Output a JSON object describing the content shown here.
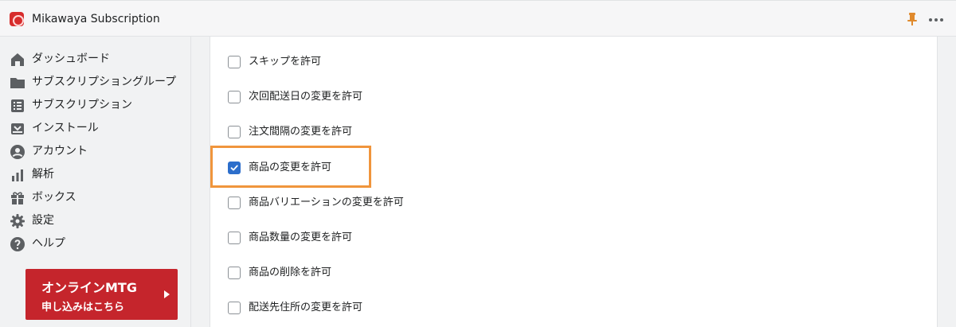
{
  "app": {
    "title": "Mikawaya Subscription"
  },
  "topbar": {
    "pin_icon": "pin-icon",
    "more_icon": "more-icon"
  },
  "sidebar": {
    "items": [
      {
        "label": "ダッシュボード",
        "icon": "home-icon"
      },
      {
        "label": "サブスクリプショングループ",
        "icon": "folder-icon"
      },
      {
        "label": "サブスクリプション",
        "icon": "list-icon"
      },
      {
        "label": "インストール",
        "icon": "inbox-icon"
      },
      {
        "label": "アカウント",
        "icon": "user-icon"
      },
      {
        "label": "解析",
        "icon": "analytics-icon"
      },
      {
        "label": "ボックス",
        "icon": "gift-icon"
      },
      {
        "label": "設定",
        "icon": "gear-icon"
      },
      {
        "label": "ヘルプ",
        "icon": "help-icon"
      }
    ]
  },
  "cta": {
    "title": "オンラインMTG",
    "subtitle": "申し込みはこちら"
  },
  "options": [
    {
      "label": "スキップを許可",
      "checked": false
    },
    {
      "label": "次回配送日の変更を許可",
      "checked": false
    },
    {
      "label": "注文間隔の変更を許可",
      "checked": false
    },
    {
      "label": "商品の変更を許可",
      "checked": true
    },
    {
      "label": "商品バリエーションの変更を許可",
      "checked": false
    },
    {
      "label": "商品数量の変更を許可",
      "checked": false
    },
    {
      "label": "商品の削除を許可",
      "checked": false
    },
    {
      "label": "配送先住所の変更を許可",
      "checked": false
    }
  ],
  "colors": {
    "accent": "#2c6ecb",
    "highlight": "#f0953c",
    "cta": "#c5252c"
  }
}
